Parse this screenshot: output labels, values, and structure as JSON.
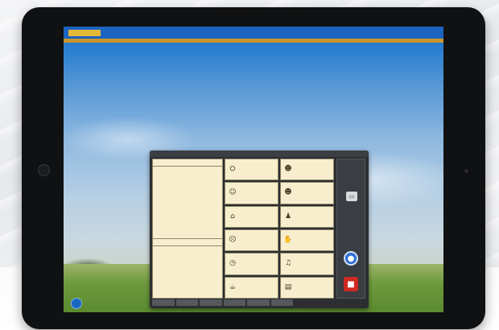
{
  "topbar": {
    "logo": "",
    "items": [
      "",
      "",
      "",
      "",
      ""
    ]
  },
  "subbar": {
    "left": "",
    "right": ""
  },
  "app": {
    "left_header": "",
    "left_sub": "",
    "side_label": "",
    "cells": [
      {
        "icon": "toilet-icon",
        "glyph": "⛭",
        "label": ""
      },
      {
        "icon": "people-icon",
        "glyph": "☻",
        "label": ""
      },
      {
        "icon": "person-icon",
        "glyph": "☺",
        "label": ""
      },
      {
        "icon": "family-icon",
        "glyph": "☻",
        "label": ""
      },
      {
        "icon": "house-icon",
        "glyph": "⌂",
        "label": ""
      },
      {
        "icon": "activity-icon",
        "glyph": "♟",
        "label": ""
      },
      {
        "icon": "sad-face-icon",
        "glyph": "☹",
        "label": ""
      },
      {
        "icon": "hand-icon",
        "glyph": "✋",
        "label": ""
      },
      {
        "icon": "clock-icon",
        "glyph": "◷",
        "label": ""
      },
      {
        "icon": "music-icon",
        "glyph": "♫",
        "label": ""
      },
      {
        "icon": "food-icon",
        "glyph": "☕",
        "label": ""
      },
      {
        "icon": "book-icon",
        "glyph": "▤",
        "label": ""
      }
    ]
  },
  "colors": {
    "accent_blue": "#1b64c0",
    "panel_dark": "#2c2e31",
    "cell_bg": "#f6eecd",
    "stop_red": "#cf2a22",
    "speak_blue": "#2f6fd0"
  }
}
